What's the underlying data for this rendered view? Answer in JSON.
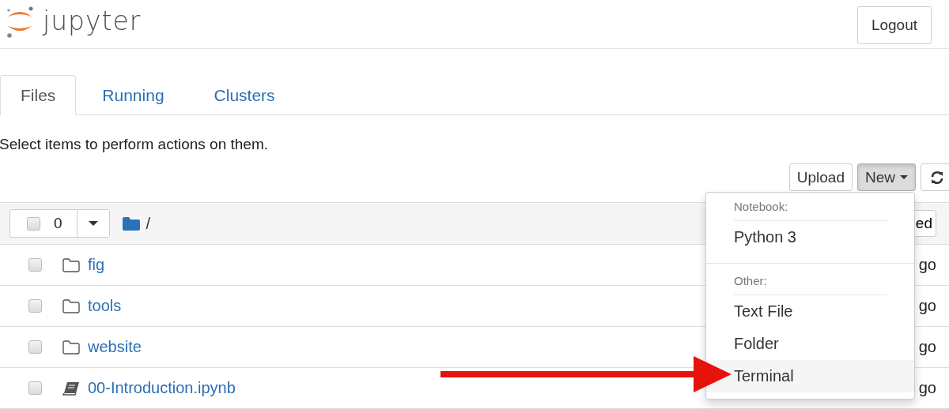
{
  "header": {
    "logo": "jupyter",
    "logout": "Logout"
  },
  "tabs": [
    {
      "label": "Files",
      "selected": true
    },
    {
      "label": "Running",
      "selected": false
    },
    {
      "label": "Clusters",
      "selected": false
    }
  ],
  "hint": "Select items to perform actions on them.",
  "toolbar": {
    "upload": "Upload",
    "new": "New",
    "new_open": true
  },
  "list_header": {
    "count": "0",
    "checked": false,
    "path": "/",
    "column_end": "ed"
  },
  "rows": [
    {
      "kind": "folder",
      "name": "fig",
      "checked": false,
      "column_end": "go"
    },
    {
      "kind": "folder",
      "name": "tools",
      "checked": false,
      "column_end": "go"
    },
    {
      "kind": "folder",
      "name": "website",
      "checked": false,
      "column_end": "go"
    },
    {
      "kind": "notebook",
      "name": "00-Introduction.ipynb",
      "checked": false,
      "column_end": "go"
    }
  ],
  "new_menu": {
    "sections": [
      {
        "heading": "Notebook:",
        "items": [
          {
            "label": "Python 3",
            "highlighted": false
          }
        ]
      },
      {
        "heading": "Other:",
        "items": [
          {
            "label": "Text File",
            "highlighted": false
          },
          {
            "label": "Folder",
            "highlighted": false
          },
          {
            "label": "Terminal",
            "highlighted": true
          }
        ]
      }
    ]
  }
}
